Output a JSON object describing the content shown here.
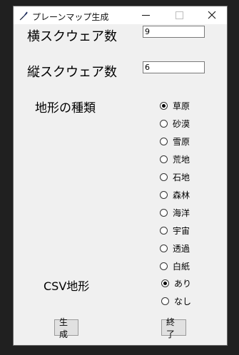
{
  "window": {
    "title": "プレーンマップ生成"
  },
  "fields": {
    "horizontal_label": "横スクウェア数",
    "horizontal_value": "9",
    "vertical_label": "縦スクウェア数",
    "vertical_value": "6"
  },
  "terrain": {
    "label": "地形の種類",
    "options": [
      "草原",
      "砂漠",
      "雪原",
      "荒地",
      "石地",
      "森林",
      "海洋",
      "宇宙",
      "透過",
      "白紙"
    ],
    "selected": "草原"
  },
  "csv": {
    "label": "CSV地形",
    "options": [
      "あり",
      "なし"
    ],
    "selected": "あり"
  },
  "buttons": {
    "generate_label": "生成",
    "quit_label": "終了"
  },
  "icons": {
    "app": "feather-icon",
    "minimize": "minimize-icon",
    "maximize": "maximize-icon",
    "close": "close-icon"
  }
}
